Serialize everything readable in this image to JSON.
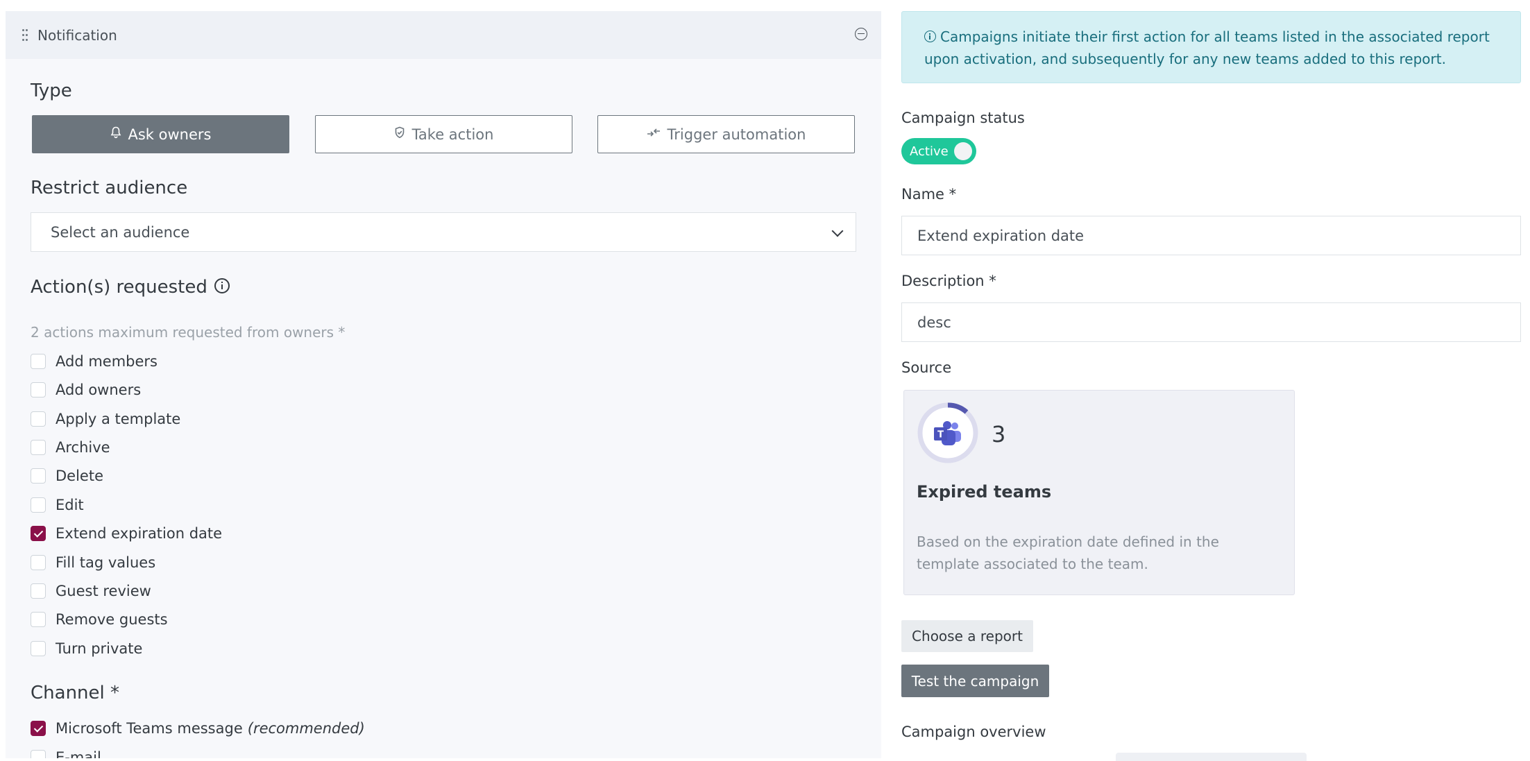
{
  "notification_panel": {
    "header_title": "Notification",
    "type_section": {
      "title": "Type",
      "options": [
        {
          "label": "Ask owners",
          "icon": "bell-icon",
          "selected": true
        },
        {
          "label": "Take action",
          "icon": "shield-check-icon",
          "selected": false
        },
        {
          "label": "Trigger automation",
          "icon": "arrows-icon",
          "selected": false
        }
      ]
    },
    "audience_section": {
      "title": "Restrict audience",
      "select_value": "Select an audience"
    },
    "actions_section": {
      "title": "Action(s) requested",
      "hint": "2 actions maximum requested from owners *",
      "items": [
        {
          "label": "Add members",
          "checked": false
        },
        {
          "label": "Add owners",
          "checked": false
        },
        {
          "label": "Apply a template",
          "checked": false
        },
        {
          "label": "Archive",
          "checked": false
        },
        {
          "label": "Delete",
          "checked": false
        },
        {
          "label": "Edit",
          "checked": false
        },
        {
          "label": "Extend expiration date",
          "checked": true
        },
        {
          "label": "Fill tag values",
          "checked": false
        },
        {
          "label": "Guest review",
          "checked": false
        },
        {
          "label": "Remove guests",
          "checked": false
        },
        {
          "label": "Turn private",
          "checked": false
        }
      ]
    },
    "channel_section": {
      "title": "Channel *",
      "items": [
        {
          "label": "Microsoft Teams message",
          "suffix": "(recommended)",
          "checked": true
        },
        {
          "label": "E-mail",
          "suffix": "",
          "checked": false
        }
      ]
    }
  },
  "campaign_panel": {
    "info_alert": "Campaigns initiate their first action for all teams listed in the associated report upon activation, and subsequently for any new teams added to this report.",
    "status": {
      "label": "Campaign status",
      "toggle_text": "Active",
      "active": true
    },
    "name": {
      "label": "Name *",
      "value": "Extend expiration date"
    },
    "description": {
      "label": "Description *",
      "value": "desc"
    },
    "source": {
      "label": "Source",
      "count": "3",
      "title": "Expired teams",
      "description": "Based on the expiration date defined in the template associated to the team."
    },
    "choose_report_label": "Choose a report",
    "test_campaign_label": "Test the campaign",
    "overview_label": "Campaign overview"
  },
  "colors": {
    "accent_checkbox": "#8a1049",
    "toggle_active": "#1fc79a",
    "info_bg": "#d5f0f4",
    "button_dark": "#6c757d"
  }
}
